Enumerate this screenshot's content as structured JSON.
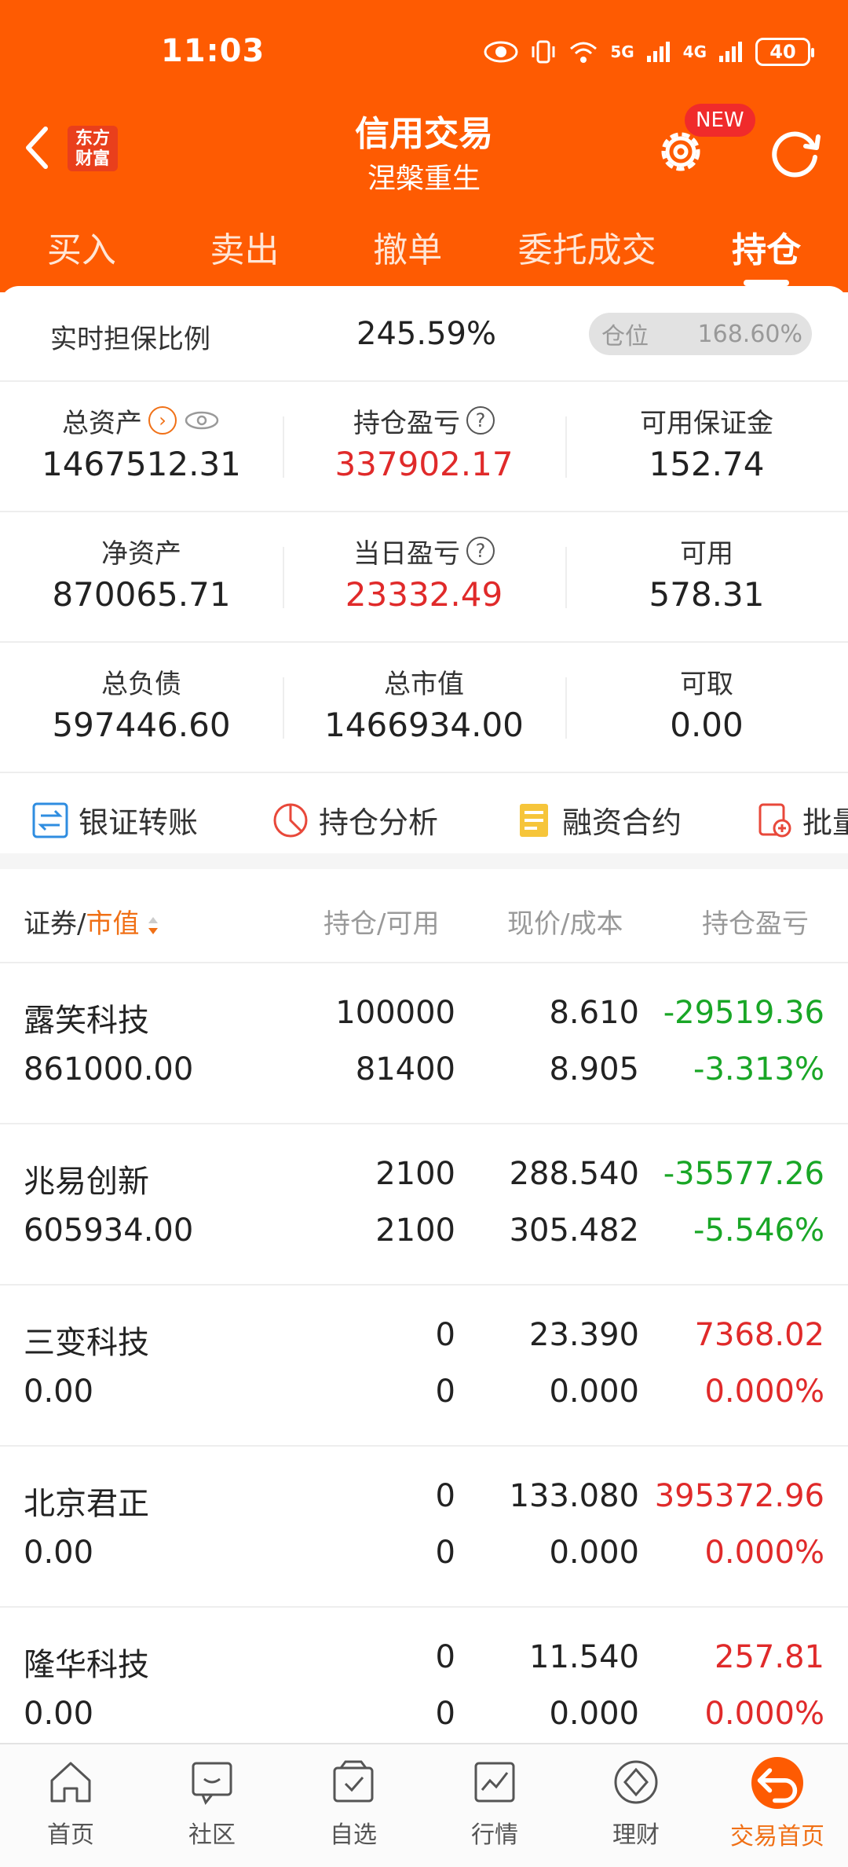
{
  "status_bar": {
    "time": "11:03",
    "net1": "5G",
    "net2": "4G",
    "battery": "40"
  },
  "header": {
    "logo_line1": "东方",
    "logo_line2": "财富",
    "title": "信用交易",
    "subtitle": "涅槃重生",
    "new_badge": "NEW"
  },
  "tabs": [
    {
      "label": "买入"
    },
    {
      "label": "卖出"
    },
    {
      "label": "撤单"
    },
    {
      "label": "委托成交"
    },
    {
      "label": "持仓"
    }
  ],
  "summary": {
    "ratio_label": "实时担保比例",
    "ratio_value": "245.59%",
    "position_label": "仓位",
    "position_value": "168.60%"
  },
  "metrics": {
    "total_assets_label": "总资产",
    "total_assets": "1467512.31",
    "holding_pl_label": "持仓盈亏",
    "holding_pl": "337902.17",
    "margin_label": "可用保证金",
    "margin": "152.74",
    "net_assets_label": "净资产",
    "net_assets": "870065.71",
    "daily_pl_label": "当日盈亏",
    "daily_pl": "23332.49",
    "available_label": "可用",
    "available": "578.31",
    "total_liab_label": "总负债",
    "total_liab": "597446.60",
    "total_mv_label": "总市值",
    "total_mv": "1466934.00",
    "withdrawable_label": "可取",
    "withdrawable": "0.00"
  },
  "quick_actions": [
    {
      "label": "银证转账"
    },
    {
      "label": "持仓分析"
    },
    {
      "label": "融资合约"
    },
    {
      "label": "批量"
    }
  ],
  "table": {
    "col_security": "证券",
    "col_mv": "市值",
    "col_qty": "持仓/可用",
    "col_price": "现价/成本",
    "col_pl": "持仓盈亏",
    "rows": [
      {
        "name": "露笑科技",
        "mv": "861000.00",
        "qty": "100000",
        "avail": "81400",
        "price": "8.610",
        "cost": "8.905",
        "pl": "-29519.36",
        "plp": "-3.313%"
      },
      {
        "name": "兆易创新",
        "mv": "605934.00",
        "qty": "2100",
        "avail": "2100",
        "price": "288.540",
        "cost": "305.482",
        "pl": "-35577.26",
        "plp": "-5.546%"
      },
      {
        "name": "三变科技",
        "mv": "0.00",
        "qty": "0",
        "avail": "0",
        "price": "23.390",
        "cost": "0.000",
        "pl": "7368.02",
        "plp": "0.000%"
      },
      {
        "name": "北京君正",
        "mv": "0.00",
        "qty": "0",
        "avail": "0",
        "price": "133.080",
        "cost": "0.000",
        "pl": "395372.96",
        "plp": "0.000%"
      },
      {
        "name": "隆华科技",
        "mv": "0.00",
        "qty": "0",
        "avail": "0",
        "price": "11.540",
        "cost": "0.000",
        "pl": "257.81",
        "plp": "0.000%"
      }
    ]
  },
  "bottom_nav": [
    {
      "label": "首页"
    },
    {
      "label": "社区"
    },
    {
      "label": "自选"
    },
    {
      "label": "行情"
    },
    {
      "label": "理财"
    },
    {
      "label": "交易首页"
    }
  ],
  "colors": {
    "brand": "#fe5b02",
    "loss": "#19a626",
    "gain": "#e02a2a"
  }
}
